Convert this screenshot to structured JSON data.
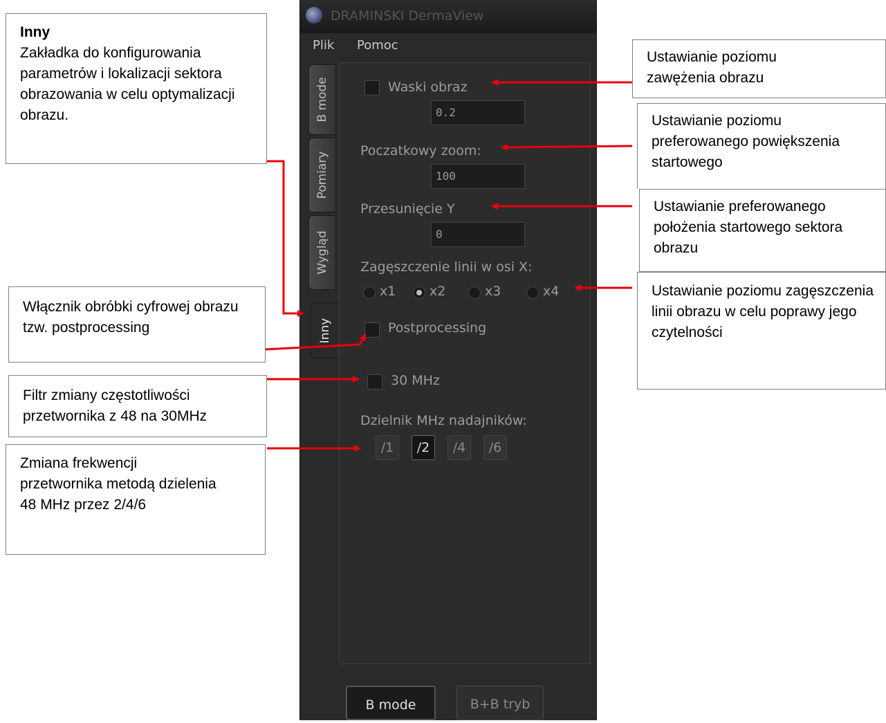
{
  "app": {
    "title": "DRAMINSKI DermaView",
    "menu": [
      "Plik",
      "Pomoc"
    ],
    "tabs": [
      "B mode",
      "Pomiary",
      "Wygląd",
      "Inny"
    ],
    "active_tab": "Inny",
    "settings": {
      "narrow_label": "Waski obraz",
      "narrow_value": "0.2",
      "zoom_label": "Poczatkowy zoom:",
      "zoom_value": "100",
      "offset_label": "Przesunięcie Y",
      "offset_value": "0",
      "density_label": "Zagęszczenie linii w osi X:",
      "density_options": [
        "x1",
        "x2",
        "x3",
        "x4"
      ],
      "density_selected": "x2",
      "postprocessing_label": "Postprocessing",
      "mhz30_label": "30 MHz",
      "divider_label": "Dzielnik MHz nadajników:",
      "divider_options": [
        "/1",
        "/2",
        "/4",
        "/6"
      ],
      "divider_selected": "/2"
    },
    "mode_buttons": [
      "B mode",
      "B+B tryb"
    ]
  },
  "callouts": {
    "inny_title": "Inny",
    "inny_text": "Zakładka do konfigurowania parametrów i lokalizacji sektora obrazowania w celu optymalizacji obrazu.",
    "postprocessing": "Włącznik obróbki cyfrowej obrazu tzw. postprocessing",
    "filter": "Filtr zmiany częstotliwości przetwornika z 48 na 30MHz",
    "divider": "Zmiana frekwencji przetwornika metodą dzielenia 48 MHz przez 2/4/6",
    "narrow": "Ustawianie poziomu zawężenia obrazu",
    "zoom": "Ustawianie poziomu preferowanego powiększenia startowego",
    "offset": "Ustawianie preferowanego położenia startowego sektora obrazu",
    "density": "Ustawianie poziomu zagęszczenia linii obrazu w celu poprawy jego czytelności"
  },
  "colors": {
    "arrow": "#e8000b",
    "panel": "#2a2a2a"
  }
}
